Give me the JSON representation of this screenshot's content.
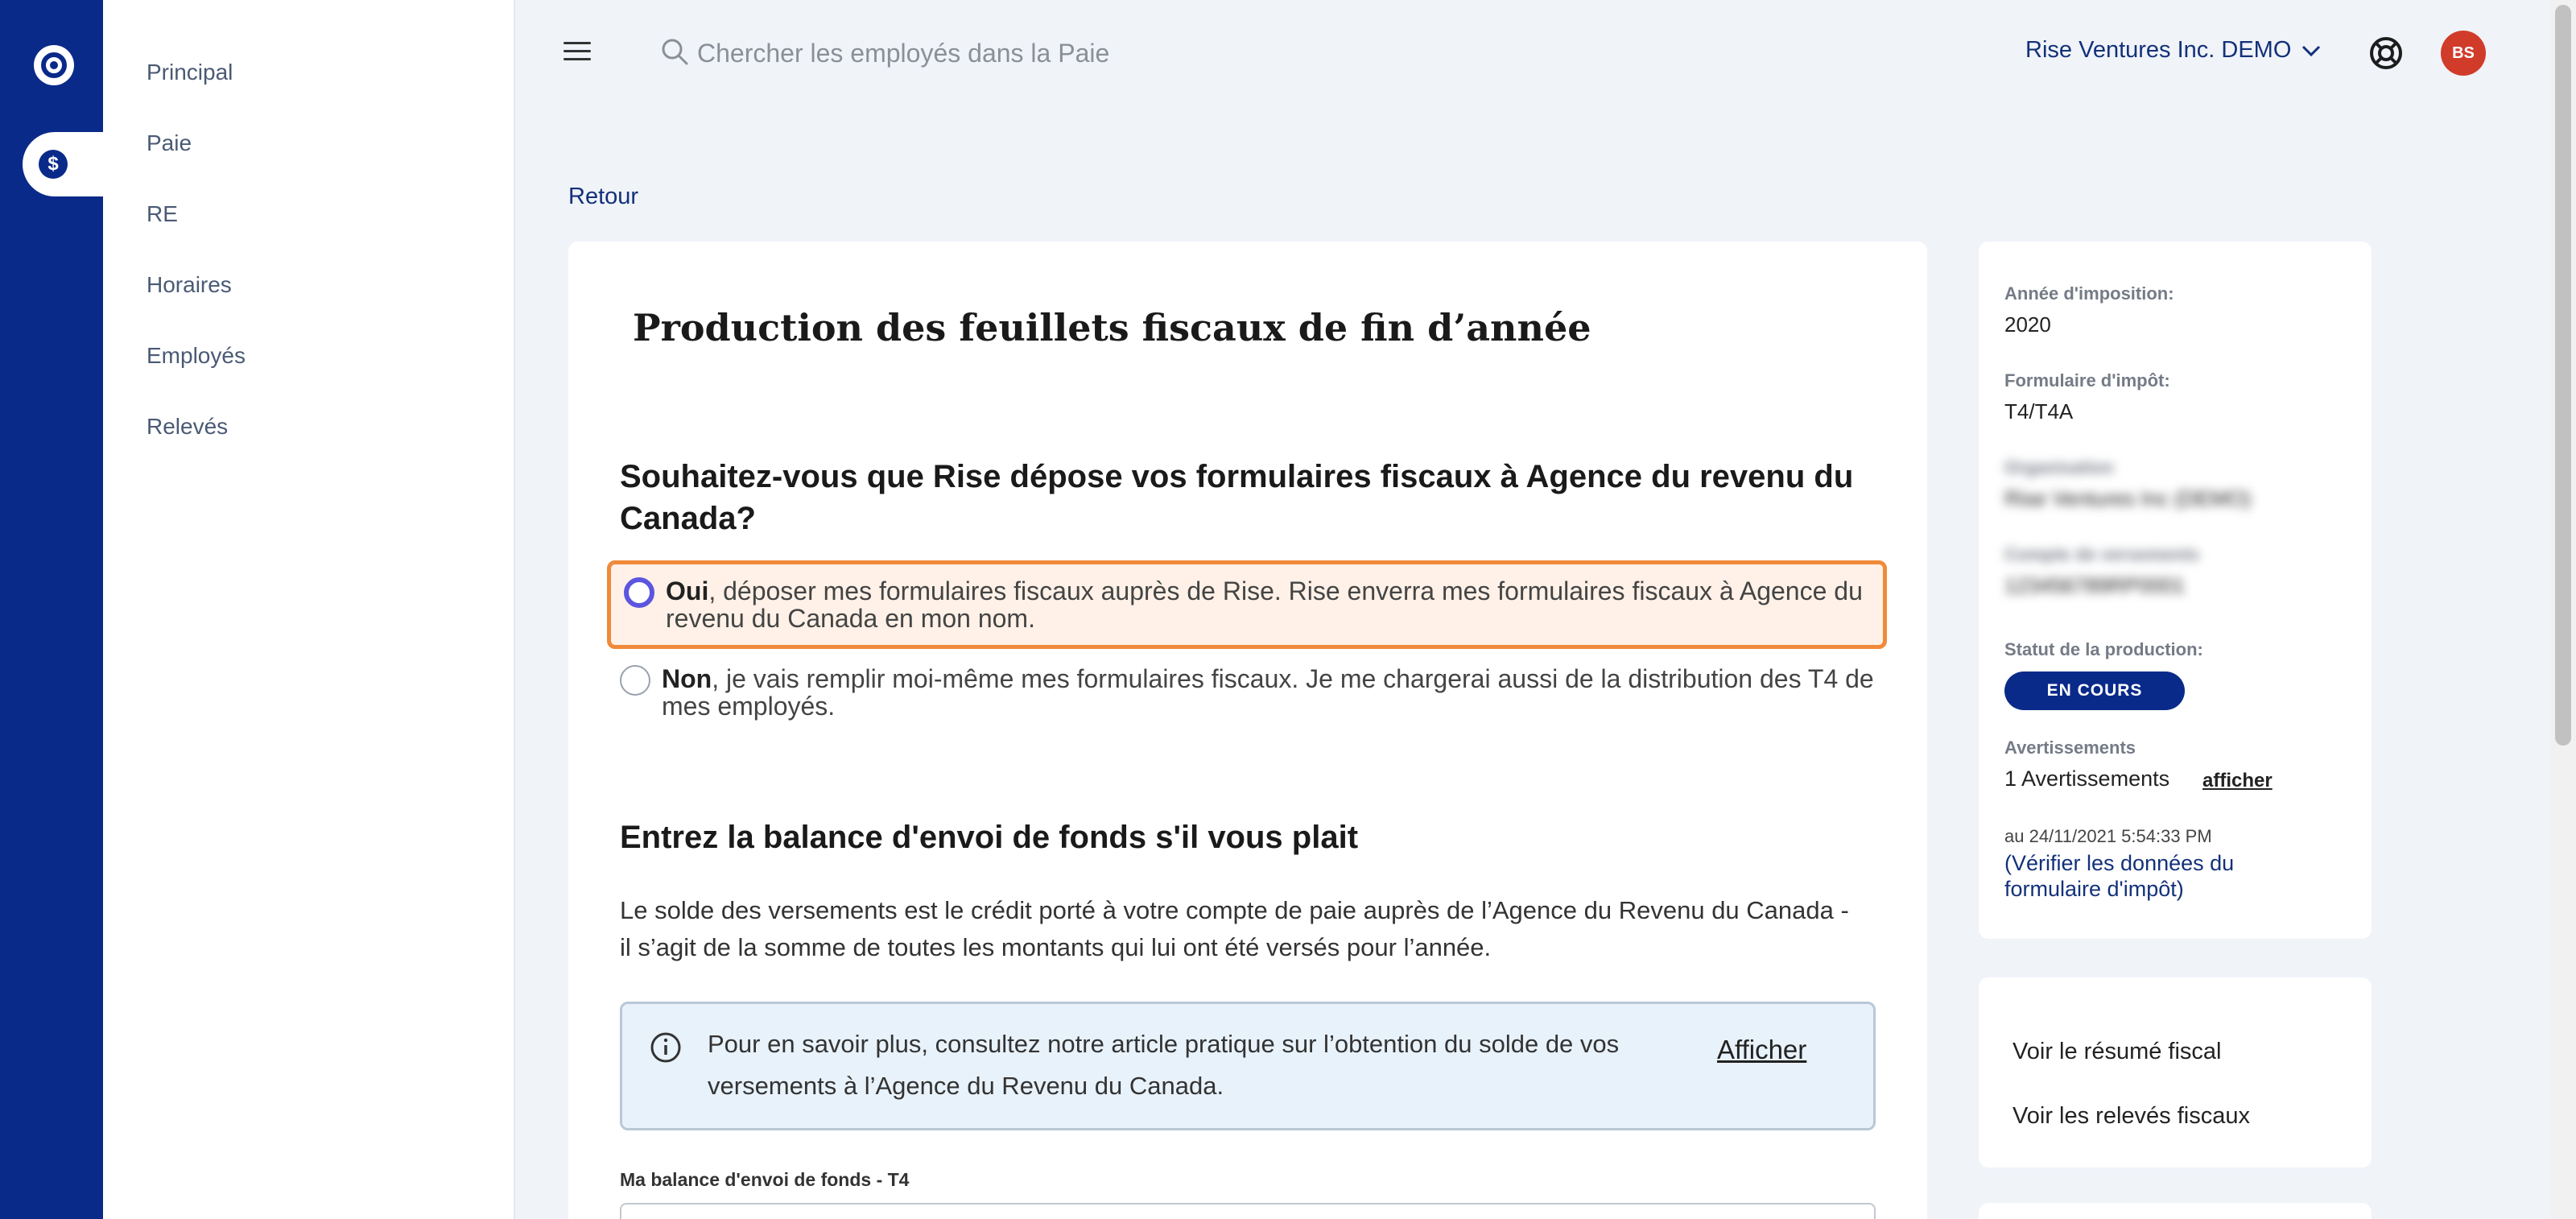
{
  "sidebar": {
    "items": [
      {
        "label": "Principal"
      },
      {
        "label": "Paie"
      },
      {
        "label": "RE"
      },
      {
        "label": "Horaires"
      },
      {
        "label": "Employés"
      },
      {
        "label": "Relevés"
      }
    ]
  },
  "topbar": {
    "search_placeholder": "Chercher les employés dans la Paie",
    "company": "Rise Ventures Inc. DEMO",
    "avatar_initials": "BS"
  },
  "main": {
    "back_label": "Retour",
    "title": "Production des feuillets fiscaux de fin d’année",
    "question": "Souhaitez-vous que Rise dépose vos formulaires fiscaux à Agence du revenu du Canada?",
    "option_yes_bold": "Oui",
    "option_yes_text": ", déposer mes formulaires fiscaux auprès de Rise. Rise enverra mes formulaires fiscaux à Agence du revenu du Canada en mon nom.",
    "option_no_bold": "Non",
    "option_no_text": ", je vais remplir moi-même mes formulaires fiscaux. Je me chargerai aussi de la distribution des T4 de mes employés.",
    "section_title": "Entrez la balance d'envoi de fonds s'il vous plait",
    "paragraph": "Le solde des versements est le crédit porté à votre compte de paie auprès de l’Agence du Revenu du Canada - il s’agit de la somme de toutes les montants qui lui ont été versés pour l’année.",
    "info_text": "Pour en savoir plus, consultez notre article pratique sur l’obtention du solde de vos versements à l’Agence du Revenu du Canada.",
    "info_link": "Afficher",
    "field_label": "Ma balance d'envoi de fonds - T4"
  },
  "info_card": {
    "year_label": "Année d'imposition:",
    "year_value": "2020",
    "form_label": "Formulaire d'impôt:",
    "form_value": "T4/T4A",
    "org_label": "Organisation",
    "org_value": "Rise Ventures Inc (DEMO)",
    "account_label": "Compte de versements",
    "account_value": "123456789RP0001",
    "status_label": "Statut de la production:",
    "status_value": "EN COURS",
    "warnings_label": "Avertissements",
    "warnings_count": "1 Avertissements",
    "warnings_link": "afficher",
    "as_of": "au 24/11/2021 5:54:33 PM",
    "verify_link": "Vérifier les données du formulaire d'impôt"
  },
  "links_card": {
    "summary": "Voir le résumé fiscal",
    "slips": "Voir les relevés fiscaux"
  },
  "colors": {
    "rail": "#0a2a8a",
    "accent_orange": "#f08a3a",
    "radio_selected": "#5b55e0",
    "avatar": "#d13b2a"
  }
}
